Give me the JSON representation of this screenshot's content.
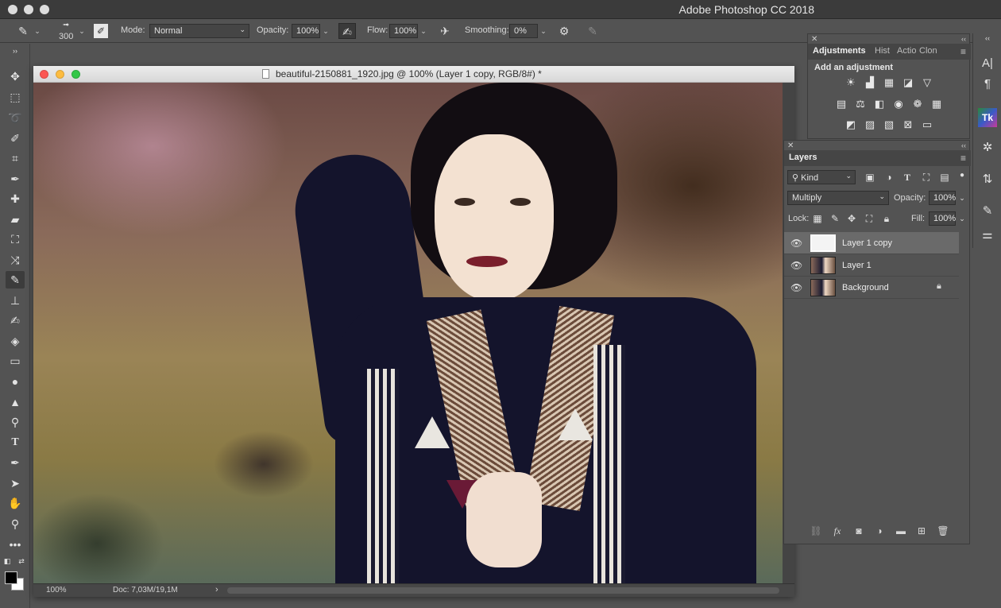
{
  "app": {
    "title": "Adobe Photoshop CC 2018"
  },
  "options_bar": {
    "brush_size": "300",
    "mode_label": "Mode:",
    "mode_value": "Normal",
    "opacity_label": "Opacity:",
    "opacity_value": "100%",
    "flow_label": "Flow:",
    "flow_value": "100%",
    "smoothing_label": "Smoothing:",
    "smoothing_value": "0%"
  },
  "tools": [
    "move-tool-icon",
    "marquee-tool-icon",
    "lasso-tool-icon",
    "quick-selection-tool-icon",
    "crop-tool-icon",
    "eyedropper-tool-icon",
    "healing-brush-tool-icon",
    "pencil-ruler-icon",
    "frame-tool-icon",
    "patch-tool-icon",
    "brush-tool-icon",
    "clone-stamp-tool-icon",
    "history-brush-tool-icon",
    "eraser-tool-icon",
    "gradient-tool-icon",
    "blur-tool-icon",
    "sharpen-tool-icon",
    "dodge-tool-icon",
    "type-tool-icon",
    "pen-tool-icon",
    "path-selection-tool-icon",
    "hand-tool-icon",
    "zoom-tool-icon",
    "more-tools-icon"
  ],
  "document": {
    "title": "beautiful-2150881_1920.jpg @ 100% (Layer 1 copy, RGB/8#) *",
    "zoom": "100%",
    "doc_size": "Doc: 7,03M/19,1M"
  },
  "adjustments": {
    "tabs": [
      "Adjustments",
      "Hist",
      "Actio",
      "Clon"
    ],
    "hint": "Add an adjustment"
  },
  "layers": {
    "tab": "Layers",
    "filter_kind": "Kind",
    "blend_mode": "Multiply",
    "opacity_label": "Opacity:",
    "opacity_value": "100%",
    "lock_label": "Lock:",
    "fill_label": "Fill:",
    "fill_value": "100%",
    "items": [
      {
        "name": "Layer 1 copy",
        "selected": true
      },
      {
        "name": "Layer 1",
        "selected": false
      },
      {
        "name": "Background",
        "selected": false,
        "locked": true
      }
    ]
  },
  "colors": {
    "ui_bg": "#535353",
    "panel_dark": "#454545",
    "selected_row": "#6a6a6a",
    "close_red": "#fc5753",
    "minimize_yellow": "#fdbc40",
    "zoom_green": "#33c748"
  }
}
